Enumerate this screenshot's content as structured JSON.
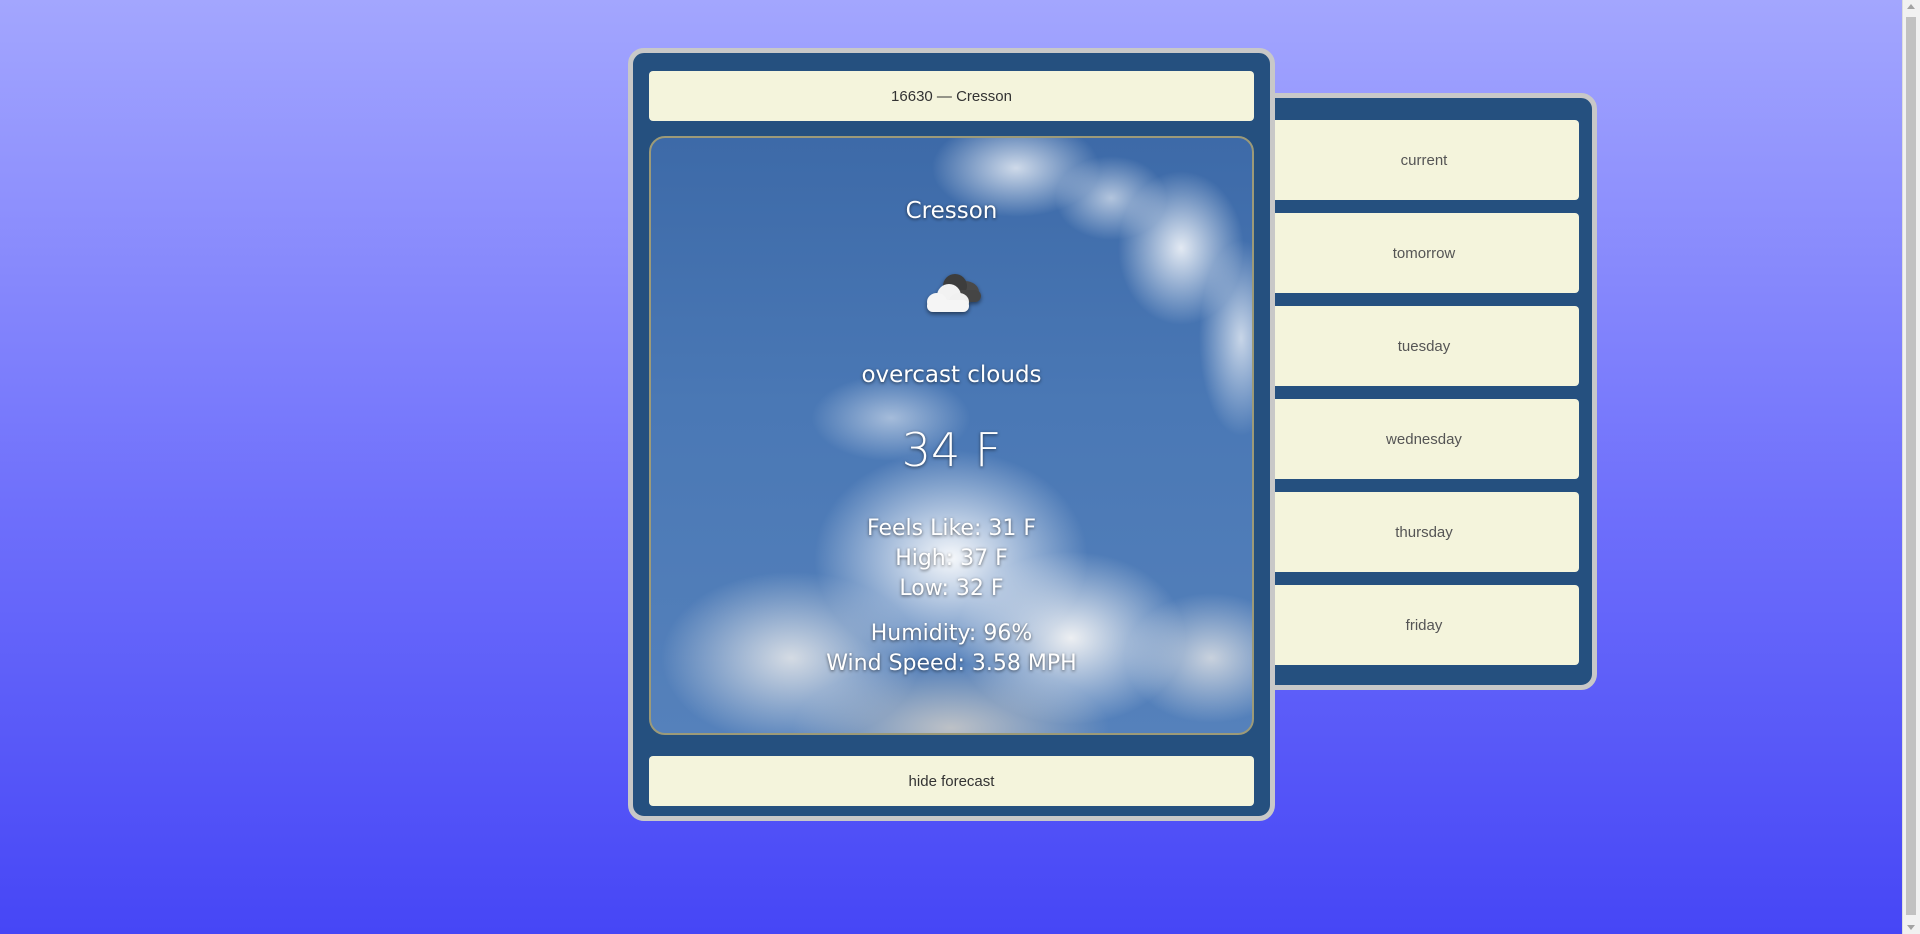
{
  "location_button": "16630 — Cresson",
  "hide_button": "hide forecast",
  "weather": {
    "city": "Cresson",
    "icon": "cloud-icon",
    "description": "overcast clouds",
    "temperature": "34 F",
    "feels_like": "Feels Like: 31 F",
    "high": "High: 37 F",
    "low": "Low: 32 F",
    "humidity": "Humidity: 96%",
    "wind_speed": "Wind Speed: 3.58 MPH"
  },
  "forecast": {
    "days": [
      "current",
      "tomorrow",
      "tuesday",
      "wednesday",
      "thursday",
      "friday"
    ]
  },
  "colors": {
    "panel": "#25507f",
    "button": "#f4f4dc",
    "border": "#c8c8c8"
  }
}
